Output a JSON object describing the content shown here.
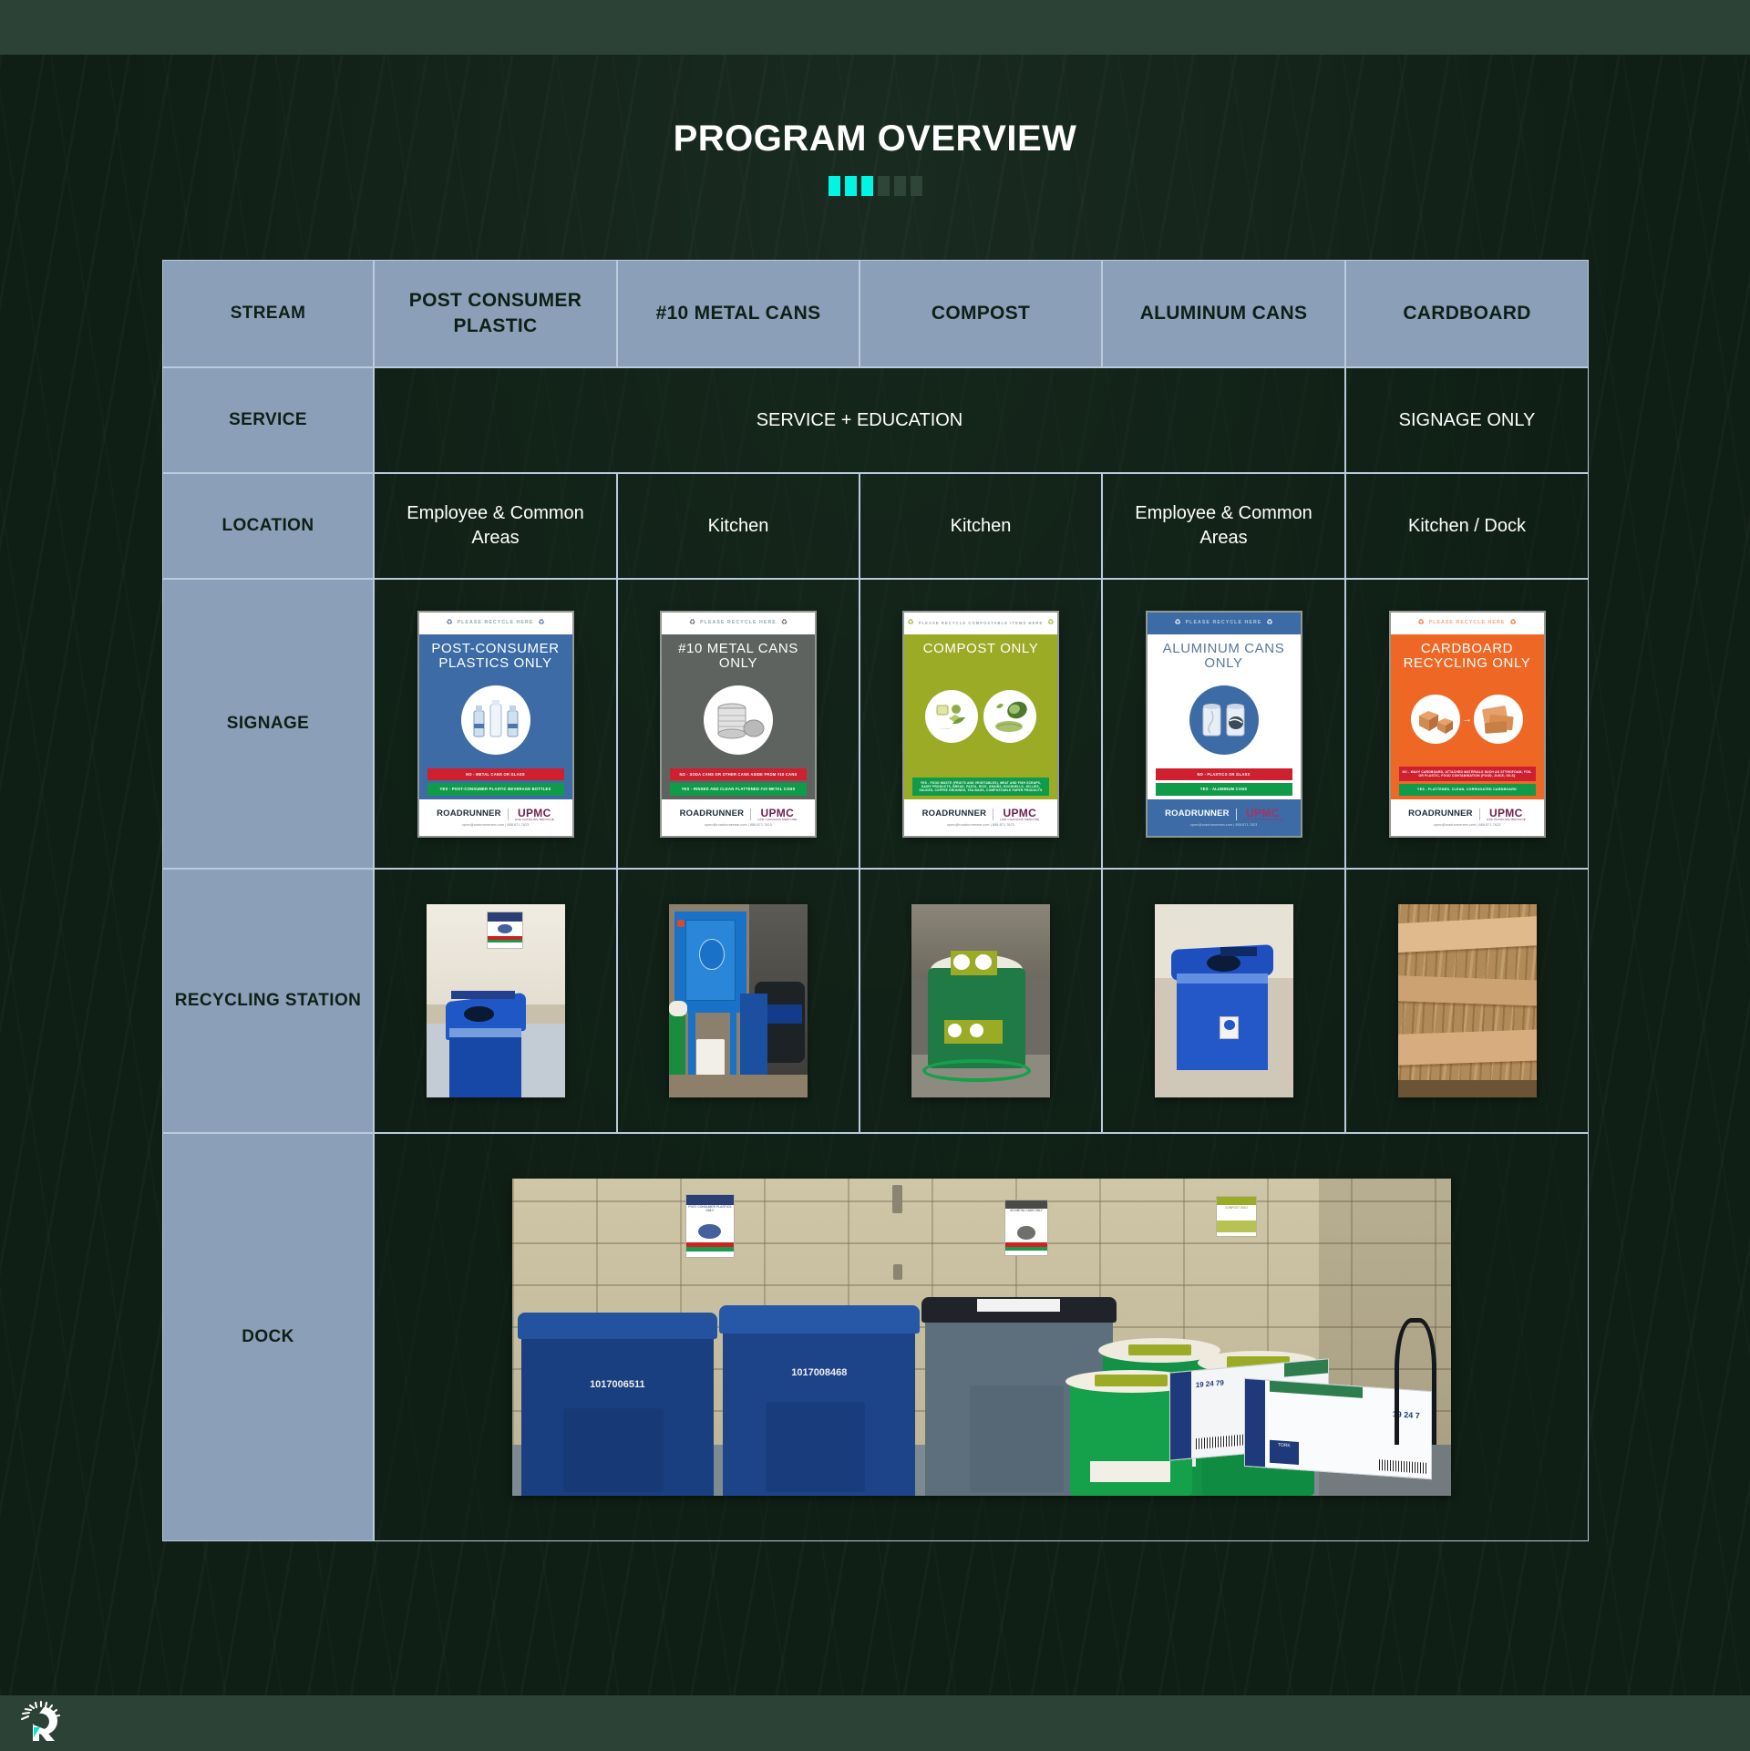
{
  "slide": {
    "title": "PROGRAM OVERVIEW",
    "accent_bars": {
      "active_color": "#00f5e4",
      "inactive_color": "#2f4538",
      "active_count": 3,
      "inactive_count": 3
    },
    "background_color": "#101f16",
    "frame_color": "#2d4236",
    "header_cell_color": "#8ba0b8"
  },
  "logo": {
    "name": "roadrunner-logo",
    "accent_color": "#00e5d8"
  },
  "table": {
    "row_labels": {
      "stream": "STREAM",
      "service": "SERVICE",
      "location": "LOCATION",
      "signage": "SIGNAGE",
      "recycling_station": "RECYCLING STATION",
      "dock": "DOCK"
    },
    "columns": [
      "POST CONSUMER PLASTIC",
      "#10 METAL CANS",
      "COMPOST",
      "ALUMINUM CANS",
      "CARDBOARD"
    ],
    "service": {
      "merged_label": "SERVICE + EDUCATION",
      "cardboard_label": "SIGNAGE ONLY"
    },
    "location": [
      "Employee & Common Areas",
      "Kitchen",
      "Kitchen",
      "Employee & Common Areas",
      "Kitchen / Dock"
    ]
  },
  "signage": [
    {
      "name": "post-consumer-plastics-poster",
      "header": "PLEASE RECYCLE HERE",
      "title": "POST-CONSUMER PLASTICS ONLY",
      "no": "NO - METAL CANS OR GLASS",
      "yes": "YES - POST-CONSUMER PLASTIC BEVERAGE BOTTLES",
      "brand_left": "ROADRUNNER",
      "brand_right": "UPMC",
      "brand_right_sub": "LIFE CHANGING MEDICINE",
      "contact": "upmc@roadrunnerwm.com  |  888.871.7623",
      "bg": "#3c6ba5",
      "header_text_color": "#93a5b4"
    },
    {
      "name": "metal-cans-poster",
      "header": "PLEASE RECYCLE HERE",
      "title": "#10 METAL CANS ONLY",
      "no": "NO - SODA CANS OR OTHER CANS ASIDE FROM #10 CANS",
      "yes": "YES - RINSED AND CLEAN FLATTENED #10 METAL CANS",
      "brand_left": "ROADRUNNER",
      "brand_right": "UPMC",
      "brand_right_sub": "LIFE CHANGING MEDICINE",
      "contact": "upmc@roadrunnerwm.com  |  888.871.7623",
      "bg": "#5e6360",
      "header_text_color": "#8e9490"
    },
    {
      "name": "compost-poster",
      "header": "PLEASE RECYCLE COMPOSTABLE ITEMS HERE",
      "title": "COMPOST ONLY",
      "no": "",
      "yes": "YES - FOOD WASTE (FRUITS AND VEGETABLES), MEAT AND FISH SCRAPS, DAIRY PRODUCTS, BREAD, PASTA, RICE, GRAINS, EGGSHELLS, JELLIES, SAUCES, COFFEE GROUNDS, TEA BAGS, COMPOSTABLE PAPER PRODUCTS",
      "brand_left": "ROADRUNNER",
      "brand_right": "UPMC",
      "brand_right_sub": "LIFE CHANGING MEDICINE",
      "contact": "upmc@roadrunnerwm.com  |  888.871.7623",
      "bg": "#9bab26",
      "header_text_color": "#b4bf6a"
    },
    {
      "name": "aluminum-cans-poster",
      "header": "PLEASE RECYCLE HERE",
      "title": "ALUMINUM CANS ONLY",
      "no": "NO - PLASTICS OR GLASS",
      "yes": "YES - ALUMINUM CANS",
      "brand_left": "ROADRUNNER",
      "brand_right": "UPMC",
      "brand_right_sub": "LIFE CHANGING MEDICINE",
      "contact": "upmc@roadrunnerwm.com  |  888.871.7623",
      "bg": "#ffffff",
      "header_text_color": "#b9cbdd"
    },
    {
      "name": "cardboard-recycling-poster",
      "header": "PLEASE RECYCLE HERE",
      "title": "CARDBOARD RECYCLING ONLY",
      "no": "NO - WAXY CARDBOARD, ATTACHED MATERIALS SUCH AS STYROFOAM, FOIL OR PLASTIC, FOOD CONTAMINATION (FOOD, JUICE, OILS)",
      "yes": "YES - FLATTENED, CLEAN, CORRUGATED CARDBOARD",
      "brand_left": "ROADRUNNER",
      "brand_right": "UPMC",
      "brand_right_sub": "LIFE CHANGING MEDICINE",
      "contact": "upmc@roadrunnerwm.com  |  888.871.7623",
      "bg": "#ef6725",
      "header_text_color": "#f4a57d"
    }
  ],
  "recycling_station_photos": [
    {
      "name": "plastics-bin-photo",
      "caption": "Blue bin with post-consumer plastics sign in hallway"
    },
    {
      "name": "metal-cans-compactor-photo",
      "caption": "Blue can crusher unit in kitchen"
    },
    {
      "name": "compost-barrel-photo",
      "caption": "Green compost barrel with lid sign"
    },
    {
      "name": "aluminum-cans-bin-photo",
      "caption": "Blue aluminum cans bin"
    },
    {
      "name": "cardboard-stack-photo",
      "caption": "Stack of flattened cardboard"
    }
  ],
  "dock_photo": {
    "name": "dock-photo",
    "bin_labels": [
      "1017006511",
      "1017008468"
    ],
    "wall_signs": [
      "POST CONSUMER PLASTICS ONLY",
      "#10 METAL CANS ONLY",
      "COMPOST ONLY"
    ],
    "box_labels": [
      "19 24 79",
      "19 24 7",
      "TORK"
    ]
  }
}
